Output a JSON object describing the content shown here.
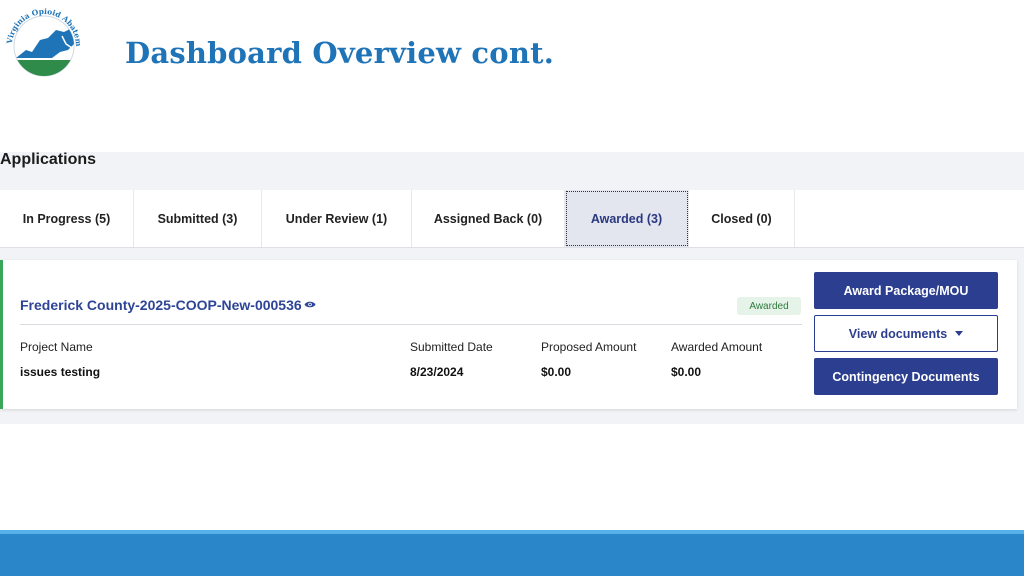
{
  "slide": {
    "title": "Dashboard Overview cont."
  },
  "logo": {
    "icon": "virginia-opioid-abatement-authority-logo",
    "text": "Virginia Opioid Abatement Authority",
    "colors": {
      "blue": "#1f74b8",
      "green": "#2e8b4a"
    }
  },
  "applications": {
    "heading": "Applications",
    "tabs": [
      {
        "label": "In Progress (5)"
      },
      {
        "label": "Submitted (3)"
      },
      {
        "label": "Under Review (1)"
      },
      {
        "label": "Assigned Back (0)"
      },
      {
        "label": "Awarded (3)"
      },
      {
        "label": "Closed (0)"
      }
    ],
    "active_tab": "Awarded (3)"
  },
  "card": {
    "title": "Frederick County-2025-COOP-New-000536",
    "status": "Awarded",
    "columns": [
      {
        "label": "Project Name",
        "value": "issues testing"
      },
      {
        "label": "Submitted Date",
        "value": "8/23/2024"
      },
      {
        "label": "Proposed Amount",
        "value": "$0.00"
      },
      {
        "label": "Awarded Amount",
        "value": "$0.00"
      }
    ],
    "buttons": {
      "award_package": "Award Package/MOU",
      "view_documents": "View documents",
      "contingency": "Contingency Documents"
    }
  },
  "colors": {
    "title_blue": "#1f74b8",
    "primary_navy": "#2c3e8f",
    "accent_green": "#3aa65a",
    "footer_blue": "#2a86c9"
  }
}
